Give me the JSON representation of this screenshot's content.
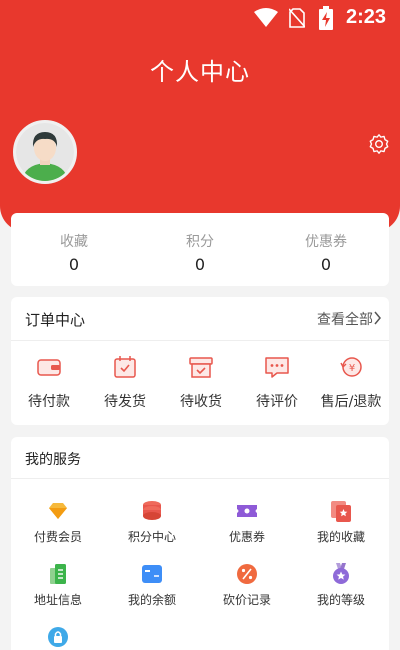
{
  "status_bar": {
    "time": "2:23"
  },
  "header": {
    "title": "个人中心"
  },
  "stats": [
    {
      "label": "收藏",
      "value": "0"
    },
    {
      "label": "积分",
      "value": "0"
    },
    {
      "label": "优惠券",
      "value": "0"
    }
  ],
  "orders": {
    "title": "订单中心",
    "view_all": "查看全部",
    "items": [
      {
        "label": "待付款",
        "icon": "wallet-icon"
      },
      {
        "label": "待发货",
        "icon": "calendar-check-icon"
      },
      {
        "label": "待收货",
        "icon": "box-check-icon"
      },
      {
        "label": "待评价",
        "icon": "chat-dots-icon"
      },
      {
        "label": "售后/退款",
        "icon": "refund-icon"
      }
    ]
  },
  "services": {
    "title": "我的服务",
    "items": [
      {
        "label": "付费会员",
        "icon": "diamond-icon"
      },
      {
        "label": "积分中心",
        "icon": "coin-stack-icon"
      },
      {
        "label": "优惠券",
        "icon": "coupon-icon"
      },
      {
        "label": "我的收藏",
        "icon": "bookmark-star-icon"
      },
      {
        "label": "地址信息",
        "icon": "address-card-icon"
      },
      {
        "label": "我的余额",
        "icon": "balance-card-icon"
      },
      {
        "label": "砍价记录",
        "icon": "discount-icon"
      },
      {
        "label": "我的等级",
        "icon": "medal-icon"
      },
      {
        "label": "",
        "icon": "lock-icon"
      }
    ]
  },
  "colors": {
    "brand_red": "#e8382d",
    "icon_red": "#e8574d"
  }
}
